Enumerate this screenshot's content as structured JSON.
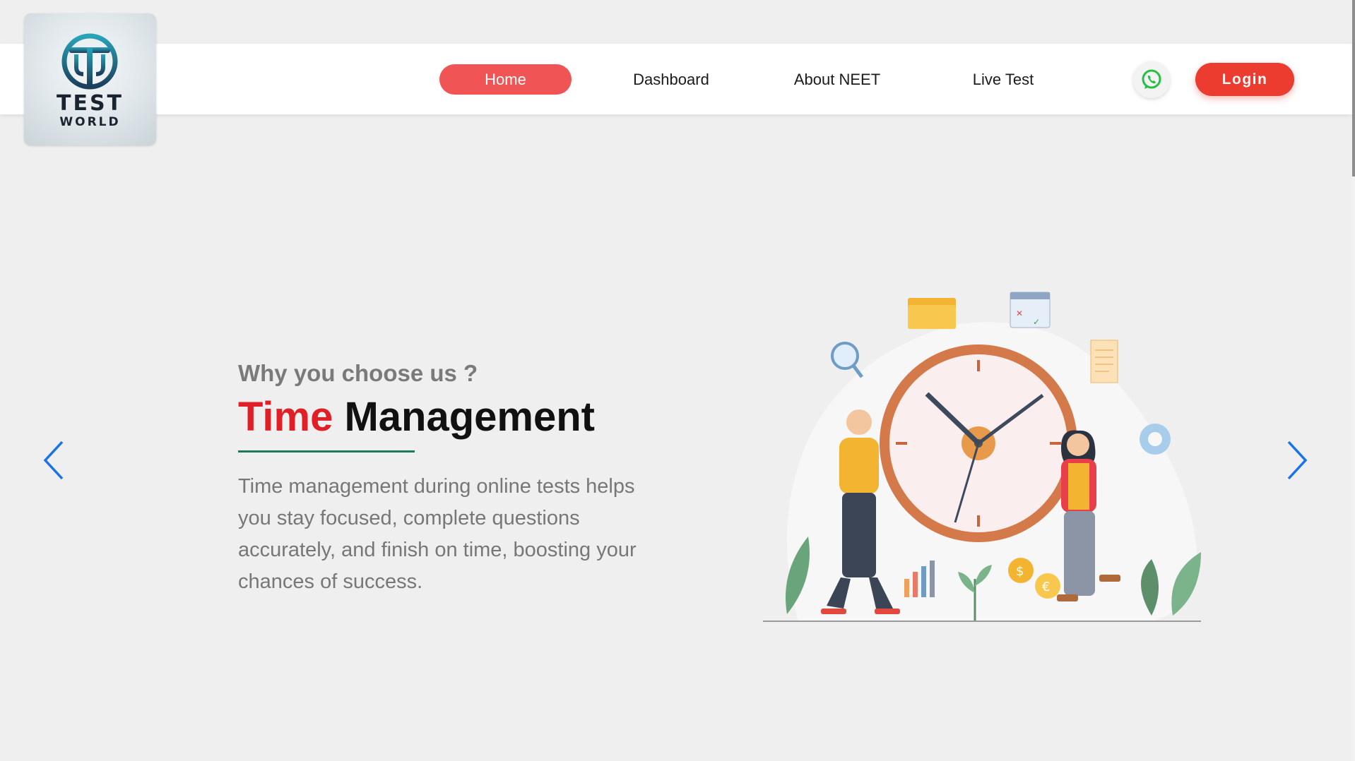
{
  "logo": {
    "line1": "TEST",
    "line2": "WORLD"
  },
  "nav": {
    "items": [
      {
        "label": "Home",
        "active": true
      },
      {
        "label": "Dashboard"
      },
      {
        "label": "About NEET"
      },
      {
        "label": "Live Test"
      }
    ],
    "login_label": "Login"
  },
  "hero": {
    "eyebrow": "Why you choose us ?",
    "headline_accent": "Time",
    "headline_rest": " Management",
    "description": "Time management during online tests helps you stay focused, complete questions accurately, and finish on time, boosting your chances of success."
  },
  "colors": {
    "accent_red": "#f05455",
    "login_red": "#ec3b2f",
    "headline_red": "#e01f26",
    "underline_green": "#1a7a5a",
    "arrow_blue": "#1a73e8"
  },
  "icons": [
    "whatsapp-icon",
    "chevron-left-icon",
    "chevron-right-icon"
  ]
}
